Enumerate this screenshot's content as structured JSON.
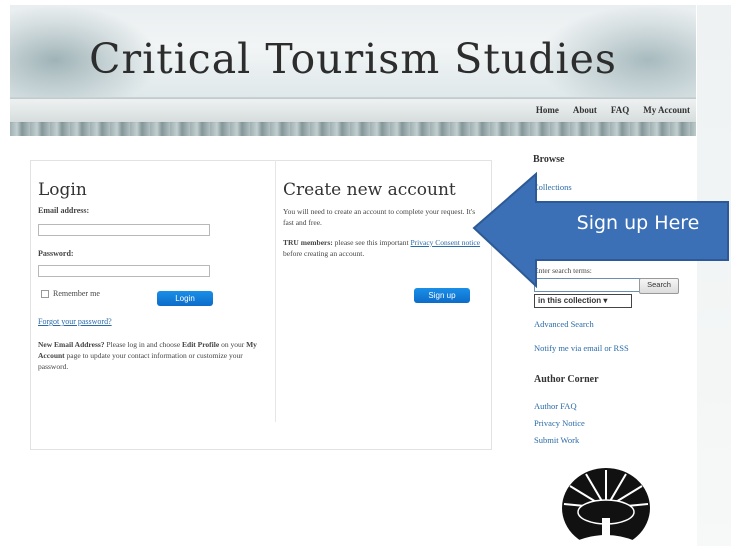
{
  "site": {
    "title": "Critical Tourism Studies"
  },
  "nav": {
    "items": [
      {
        "label": "Home"
      },
      {
        "label": "About"
      },
      {
        "label": "FAQ"
      },
      {
        "label": "My Account"
      }
    ]
  },
  "login": {
    "heading": "Login",
    "email_label": "Email address:",
    "email_value": "",
    "password_label": "Password:",
    "password_value": "",
    "remember_label": "Remember me",
    "login_button": "Login",
    "forgot_link": "Forgot your password?",
    "note_bold1": "New Email Address?",
    "note_text1": " Please log in and choose ",
    "note_bold2": "Edit Profile",
    "note_text2": " on your ",
    "note_bold3": "My Account",
    "note_text3": " page to update your contact information or customize your password."
  },
  "create": {
    "heading": "Create new account",
    "intro": "You will need to create an account to complete your request. It's fast and free.",
    "tru_bold": "TRU members:",
    "tru_text": " please see this important ",
    "tru_link": "Privacy Consent notice",
    "tru_tail": " before creating an account.",
    "signup_button": "Sign up"
  },
  "sidebar": {
    "browse_heading": "Browse",
    "collections_link": "Collections",
    "search_label": "Enter search terms:",
    "search_value": "",
    "search_button": "Search",
    "scope_selected": "in this collection",
    "advanced_link": "Advanced Search",
    "notify_link": "Notify me via email or RSS",
    "author_heading": "Author Corner",
    "author_links": [
      {
        "label": "Author FAQ"
      },
      {
        "label": "Privacy Notice"
      },
      {
        "label": "Submit Work"
      }
    ]
  },
  "callout": {
    "text": "Sign up Here",
    "fill": "#3b6fb6",
    "stroke": "#2d5a96"
  },
  "colors": {
    "button_blue": "#0c6cc9",
    "link_blue": "#2a6aa8"
  }
}
